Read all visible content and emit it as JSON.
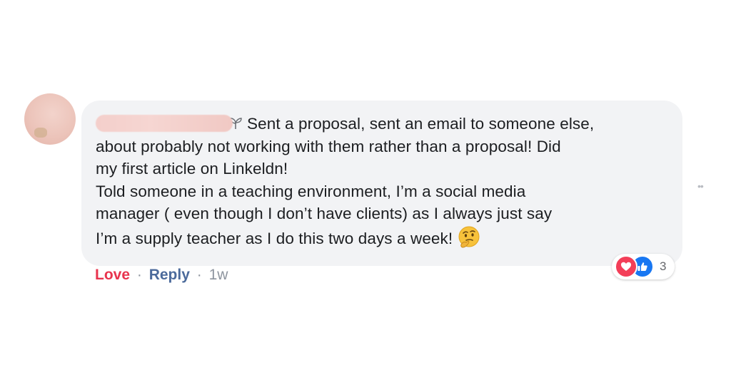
{
  "comment": {
    "author_redacted": true,
    "lines": [
      "Sent a proposal, sent an email to someone else,",
      "about probably not working with them rather than a proposal! Did",
      "my first article on Linkeldn!",
      "Told someone in a teaching environment, I’m a social media",
      "manager ( even though I don’t have clients) as I always just say",
      "I’m a supply teacher as I do this two days a week!"
    ],
    "emoji": "thinking-face"
  },
  "reactions": {
    "count": "3",
    "types": [
      "love",
      "like"
    ]
  },
  "actions": {
    "love_label": "Love",
    "reply_label": "Reply",
    "separator": "·",
    "timestamp": "1w"
  },
  "colors": {
    "bubble_bg": "#f2f3f5",
    "love": "#e8344e",
    "link": "#4b6a9b",
    "like": "#1877f2"
  }
}
